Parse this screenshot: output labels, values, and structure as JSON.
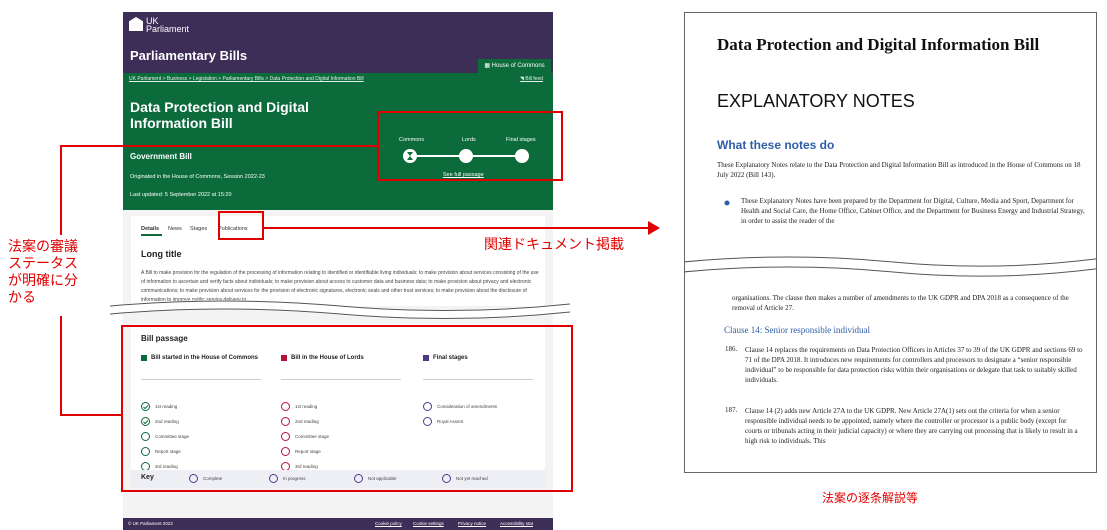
{
  "parliament_page": {
    "logo": {
      "line1": "UK",
      "line2": "Parliament"
    },
    "header_title": "Parliamentary Bills",
    "house_tab": "House of Commons",
    "breadcrumb": "UK Parliament > Business > Legislation > Parliamentary Bills > Data Protection and Digital Information Bill",
    "bill_feed": "Bill feed",
    "bill_title": "Data Protection and Digital Information Bill",
    "bill_type": "Government Bill",
    "originated": "Originated in the House of Commons, Session 2022-23",
    "last_updated": "Last updated: 5 September 2022 at 15:20",
    "stages": [
      "Commons",
      "Lords",
      "Final stages"
    ],
    "see_full_passage": "See full passage",
    "tabs": [
      "Details",
      "News",
      "Stages",
      "Publications"
    ],
    "long_title_heading": "Long title",
    "long_title_text": "A Bill to make provision for the regulation of the processing of information relating to identified or identifiable living individuals; to make provision about services consisting of the use of information to ascertain and verify facts about individuals; to make provision about access to customer data and business data; to make provision about privacy and electronic communications; to make provision about services for the provision of electronic signatures, electronic seals and other trust services; to make provision about the disclosure of information to improve public service delivery to",
    "bill_passage_heading": "Bill passage",
    "columns": [
      {
        "title": "Bill started in the House of Commons",
        "color": "#0b6b3a",
        "items": [
          {
            "label": "1st reading",
            "done": true
          },
          {
            "label": "2nd reading",
            "done": true
          },
          {
            "label": "Committee stage",
            "done": false
          },
          {
            "label": "Report stage",
            "done": false
          },
          {
            "label": "3rd reading",
            "done": false
          }
        ]
      },
      {
        "title": "Bill in the House of Lords",
        "color": "#b5123a",
        "items": [
          {
            "label": "1st reading"
          },
          {
            "label": "2nd reading"
          },
          {
            "label": "Committee stage"
          },
          {
            "label": "Report stage"
          },
          {
            "label": "3rd reading"
          }
        ]
      },
      {
        "title": "Final stages",
        "color": "#4f3a8a",
        "items": [
          {
            "label": "Consideration of amendments"
          },
          {
            "label": "Royal Assent"
          }
        ]
      }
    ],
    "key": {
      "title": "Key",
      "complete": "Complete",
      "in_progress": "In progress",
      "not_applicable": "Not applicable",
      "not_yet_reached": "Not yet reached"
    },
    "footer": {
      "copyright": "© UK Parliament 2022",
      "links": [
        "Cookie policy",
        "Cookie settings",
        "Privacy notice",
        "Accessibility stat"
      ]
    }
  },
  "annotations": {
    "status_note": "法案の審議ステータスが明確に分かる",
    "status_note_lines": [
      "法案の審議",
      "ステータス",
      "が明確に分",
      "かる"
    ],
    "documents_note": "関連ドキュメント掲載",
    "explanation_caption": "法案の逐条解説等"
  },
  "explanatory_notes": {
    "bill_title": "Data Protection and Digital Information Bill",
    "heading": "EXPLANATORY NOTES",
    "section_heading": "What these notes do",
    "intro": "These Explanatory Notes relate to the Data Protection and Digital Information Bill as introduced in the House of Commons on 18 July 2022 (Bill 143).",
    "bullet": "These Explanatory Notes have been prepared by the Department for Digital, Culture, Media and Sport, Department for Health and Social Care, the Home Office, Cabinet Office, and the Department for Business Energy and Industrial Strategy, in order to assist the reader of the",
    "continuation": "organisations. The clause then makes a number of amendments to the UK GDPR and DPA 2018 as a consequence of the removal of Article 27.",
    "clause_heading": "Clause 14: Senior responsible individual",
    "para186_num": "186.",
    "para186": "Clause 14 replaces the requirements on Data Protection Officers in Articles 37 to 39 of the UK GDPR and sections 69 to 71 of the DPA 2018. It introduces new requirements for controllers and processors to designate a “senior responsible individual” to be responsible for data protection risks within their organisations or delegate that task to suitably skilled individuals.",
    "para187_num": "187.",
    "para187": "Clause 14 (2) adds new Article 27A to the UK GDPR. New Article 27A(1) sets out the criteria for when a senior responsible individual needs to be appointed, namely where the controller or processor is a public body (except for courts or tribunals acting in their judicial capacity) or where they are carrying out processing that is likely to result in a high risk to individuals. This"
  }
}
